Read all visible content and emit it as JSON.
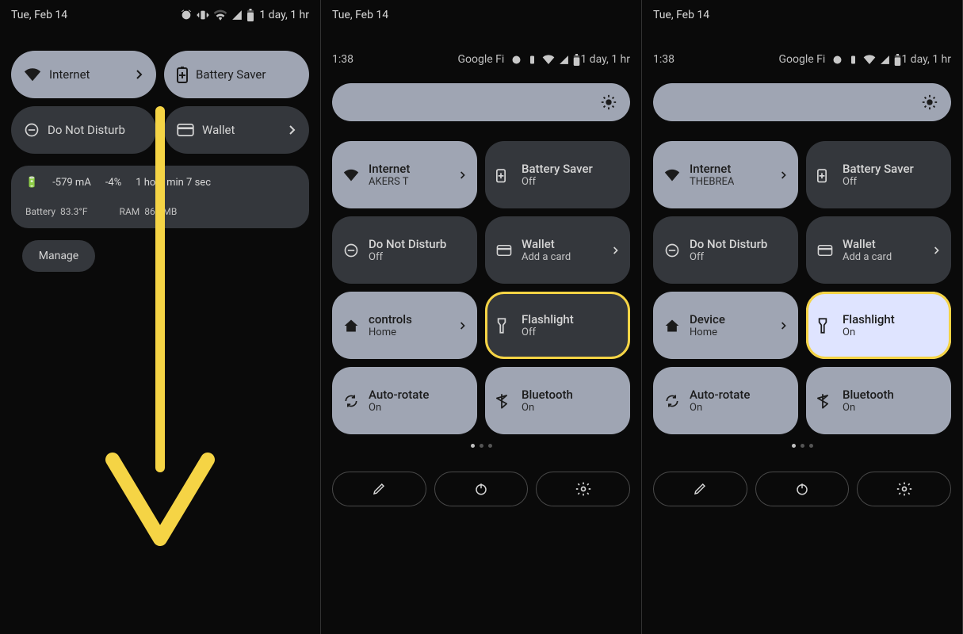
{
  "panel1": {
    "date": "Tue, Feb 14",
    "eta": "1 day, 1 hr",
    "row1": {
      "internet": "Internet",
      "battery_saver": "Battery Saver"
    },
    "row2": {
      "dnd": "Do Not Disturb",
      "wallet": "Wallet"
    },
    "battery": {
      "amps": "-579 mA",
      "pct": "-4%",
      "time": "1 ho   7 min 7 sec",
      "temp_label": "Battery",
      "temp": "83.3°F",
      "ram_label": "RAM",
      "ram": "866 MB"
    },
    "manage": "Manage"
  },
  "panel2": {
    "date": "Tue, Feb 14",
    "time": "1:38",
    "carrier": "Google Fi",
    "eta": "1 day, 1 hr",
    "tiles": {
      "internet": {
        "title": "Internet",
        "sub": "AKERS     T"
      },
      "batt_saver": {
        "title": "Battery Saver",
        "sub": "Off"
      },
      "dnd": {
        "title": "Do Not Disturb",
        "sub": "Off"
      },
      "wallet": {
        "title": "Wallet",
        "sub": "Add a card"
      },
      "home": {
        "title": "controls",
        "sub": "Home"
      },
      "flashlight": {
        "title": "Flashlight",
        "sub": "Off"
      },
      "autorotate": {
        "title": "Auto-rotate",
        "sub": "On"
      },
      "bluetooth": {
        "title": "Bluetooth",
        "sub": "On"
      }
    }
  },
  "panel3": {
    "date": "Tue, Feb 14",
    "time": "1:38",
    "carrier": "Google Fi",
    "eta": "1 day, 1 hr",
    "tiles": {
      "internet": {
        "title": "Internet",
        "sub": "THEBREA"
      },
      "batt_saver": {
        "title": "Battery Saver",
        "sub": "Off"
      },
      "dnd": {
        "title": "Do Not Disturb",
        "sub": "Off"
      },
      "wallet": {
        "title": "Wallet",
        "sub": "Add a card"
      },
      "home": {
        "title": "Device",
        "sub": "Home"
      },
      "flashlight": {
        "title": "Flashlight",
        "sub": "On"
      },
      "autorotate": {
        "title": "Auto-rotate",
        "sub": "On"
      },
      "bluetooth": {
        "title": "Bluetooth",
        "sub": "On"
      }
    }
  }
}
